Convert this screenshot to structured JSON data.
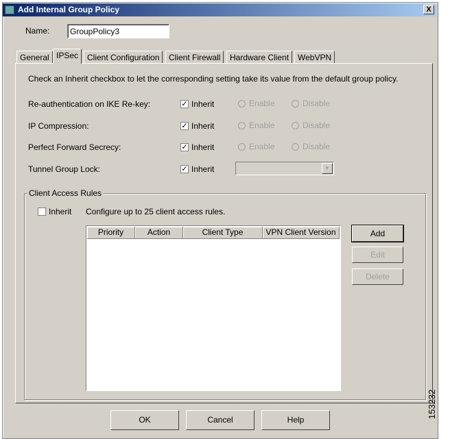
{
  "window": {
    "title": "Add Internal Group Policy",
    "close_glyph": "X"
  },
  "name": {
    "label": "Name:",
    "value": "GroupPolicy3"
  },
  "tabs": [
    {
      "label": "General"
    },
    {
      "label": "IPSec",
      "selected": true
    },
    {
      "label": "Client Configuration"
    },
    {
      "label": "Client Firewall"
    },
    {
      "label": "Hardware Client"
    },
    {
      "label": "WebVPN"
    }
  ],
  "instructions": "Check an Inherit checkbox to let the corresponding setting take its value from the default group policy.",
  "settings": [
    {
      "label": "Re-authentication on IKE Re-key:",
      "inherit": "Inherit",
      "enable": "Enable",
      "disable": "Disable"
    },
    {
      "label": "IP Compression:",
      "inherit": "Inherit",
      "enable": "Enable",
      "disable": "Disable"
    },
    {
      "label": "Perfect Forward Secrecy:",
      "inherit": "Inherit",
      "enable": "Enable",
      "disable": "Disable"
    },
    {
      "label": "Tunnel Group Lock:",
      "inherit": "Inherit"
    }
  ],
  "check_glyph": "✓",
  "client_access": {
    "legend": "Client Access Rules",
    "inherit": "Inherit",
    "note": "Configure up to 25 client access rules.",
    "columns": [
      "Priority",
      "Action",
      "Client Type",
      "VPN Client Version"
    ],
    "buttons": {
      "add": "Add",
      "edit": "Edit",
      "delete": "Delete"
    }
  },
  "footer": {
    "ok": "OK",
    "cancel": "Cancel",
    "help": "Help"
  },
  "figure_id": "153232"
}
